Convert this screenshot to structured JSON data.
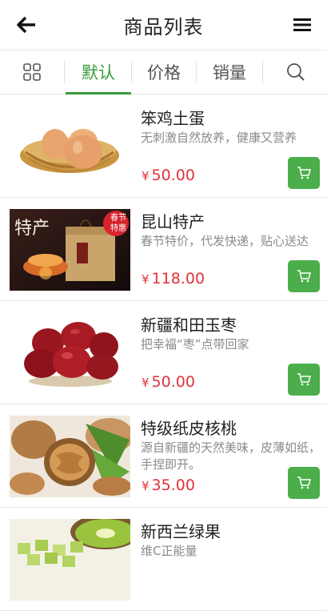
{
  "header": {
    "title": "商品列表"
  },
  "tabs": [
    {
      "label": "默认",
      "active": true
    },
    {
      "label": "价格",
      "active": false
    },
    {
      "label": "销量",
      "active": false
    }
  ],
  "products": [
    {
      "name": "笨鸡土蛋",
      "desc": "无刺激自然放养，健康又营养",
      "currency": "¥",
      "price": "50.00",
      "image": "eggs"
    },
    {
      "name": "昆山特产",
      "desc": "春节特价，代发快递，贴心送达",
      "currency": "¥",
      "price": "118.00",
      "image": "gift-box",
      "badge": "春节\n特惠",
      "image_text": "特产"
    },
    {
      "name": "新疆和田玉枣",
      "desc": "把幸福“枣”点带回家",
      "currency": "¥",
      "price": "50.00",
      "image": "jujubes"
    },
    {
      "name": "特级纸皮核桃",
      "desc": "源自新疆的天然美味，皮薄如纸，手捏即开。",
      "currency": "¥",
      "price": "35.00",
      "image": "walnuts"
    },
    {
      "name": "新西兰绿果",
      "desc": "维C正能量",
      "currency": "¥",
      "price": "",
      "image": "kiwi"
    }
  ],
  "colors": {
    "accent": "#3b9b3b",
    "cart": "#4bae4b",
    "price": "#e0323a"
  },
  "icons": {
    "back": "arrow-left-icon",
    "menu": "hamburger-icon",
    "grid": "grid-icon",
    "search": "search-icon",
    "cart": "cart-icon"
  }
}
